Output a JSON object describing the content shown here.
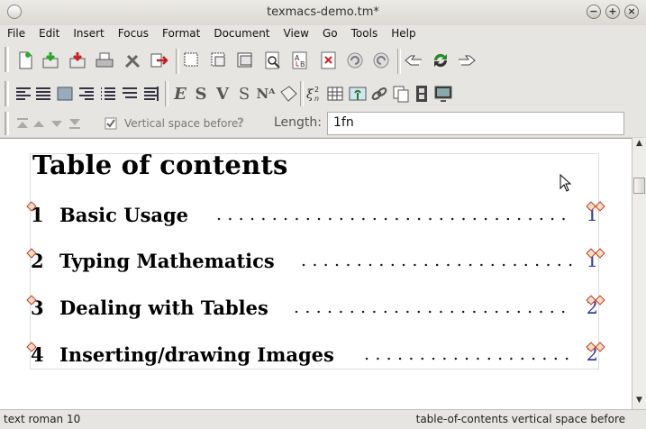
{
  "window": {
    "title": "texmacs-demo.tm*",
    "buttons": [
      "−",
      "+",
      "×"
    ]
  },
  "menubar": [
    "File",
    "Edit",
    "Insert",
    "Focus",
    "Format",
    "Document",
    "View",
    "Go",
    "Tools",
    "Help"
  ],
  "toolbar1": {
    "icons": [
      "new-document-icon",
      "open-icon",
      "save-icon",
      "print-icon",
      "preferences-icon",
      "export-icon",
      "copy-icon",
      "cut-icon",
      "paste-icon",
      "search-icon",
      "replace-icon",
      "spell-check-icon",
      "undo-icon",
      "redo-icon",
      "back-hand-icon",
      "refresh-icon",
      "forward-hand-icon"
    ]
  },
  "toolbar2": {
    "icons": [
      "align-left-icon",
      "align-justify-icon",
      "align-center-icon",
      "align-right-icon",
      "itemize-icon",
      "enumerate-icon",
      "description-icon"
    ],
    "text_icons": [
      "E",
      "S",
      "V",
      "S",
      "Nᴬ"
    ],
    "icons2": [
      "tag-icon",
      "math-icon",
      "table-icon",
      "image-icon",
      "link-icon",
      "copy-pages-icon",
      "animation-icon",
      "screen-icon"
    ]
  },
  "toolbar3": {
    "vspace_label": "Vertical space before",
    "help_glyph": "?",
    "length_label": "Length:",
    "length_value": "1fn"
  },
  "document": {
    "title": "Table of contents",
    "toc": [
      {
        "num": "1",
        "text": "Basic Usage",
        "page": "1"
      },
      {
        "num": "2",
        "text": "Typing Mathematics",
        "page": "1"
      },
      {
        "num": "3",
        "text": "Dealing with Tables",
        "page": "2"
      },
      {
        "num": "4",
        "text": "Inserting/drawing Images",
        "page": "2"
      }
    ]
  },
  "statusbar": {
    "left": "text roman 10",
    "right": "table-of-contents vertical space before"
  },
  "colors": {
    "page_number": "#3b3b9a",
    "marker": "#c0392b",
    "chrome": "#e7e5e1"
  }
}
